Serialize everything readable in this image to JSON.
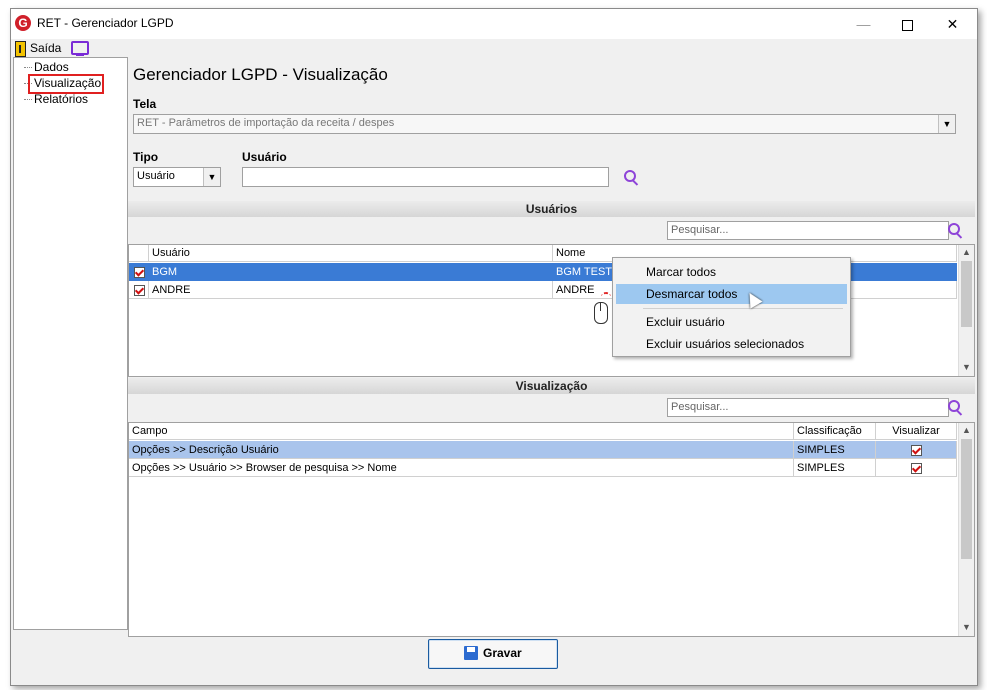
{
  "window": {
    "title": "RET - Gerenciador LGPD",
    "min": "—",
    "close": "✕"
  },
  "menubar": {
    "saida": "Saída"
  },
  "sidebar": {
    "items": [
      {
        "label": "Dados"
      },
      {
        "label": "Visualização",
        "selected": true
      },
      {
        "label": "Relatórios"
      }
    ]
  },
  "page": {
    "title": "Gerenciador LGPD - Visualização"
  },
  "tela": {
    "label": "Tela",
    "value": "RET - Parâmetros de importação da receita / despes"
  },
  "tipo": {
    "label": "Tipo",
    "value": "Usuário"
  },
  "usuario": {
    "label": "Usuário",
    "value": ""
  },
  "usuarios_section": {
    "title": "Usuários",
    "search_placeholder": "Pesquisar...",
    "columns": [
      "Usuário",
      "Nome"
    ],
    "rows": [
      {
        "checked": true,
        "usuario": "BGM",
        "nome": "BGM TESTE",
        "selected": true
      },
      {
        "checked": true,
        "usuario": "ANDRE",
        "nome": "ANDRE",
        "selected": false
      }
    ]
  },
  "context_menu": {
    "items": [
      "Marcar todos",
      "Desmarcar todos",
      "Excluir usuário",
      "Excluir usuários selecionados"
    ],
    "highlighted": "Desmarcar todos"
  },
  "visualizacao_section": {
    "title": "Visualização",
    "search_placeholder": "Pesquisar...",
    "columns": [
      "Campo",
      "Classificação",
      "Visualizar"
    ],
    "rows": [
      {
        "campo": "Opções >> Descrição Usuário",
        "classificacao": "SIMPLES",
        "visualizar": true,
        "selected": true
      },
      {
        "campo": "Opções >> Usuário >> Browser de pesquisa >> Nome",
        "classificacao": "SIMPLES",
        "visualizar": true,
        "selected": false
      }
    ]
  },
  "footer": {
    "save_label": "Gravar"
  },
  "colors": {
    "selection": "#3a7bd5",
    "light_selection": "#a9c4ec",
    "menu_highlight": "#9dc8f0",
    "accent": "#8e44d8",
    "highlight_border": "#e02020"
  }
}
